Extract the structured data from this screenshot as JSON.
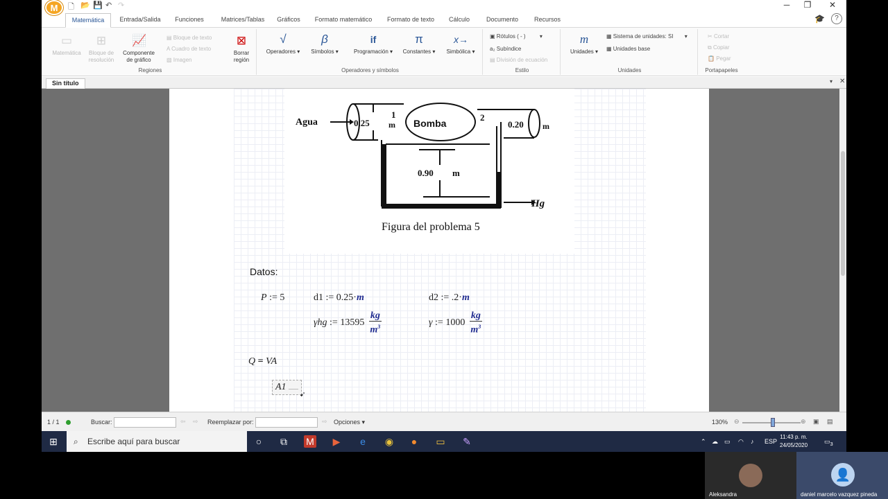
{
  "app": {
    "logo_letter": "M",
    "tabs": [
      "Matemática",
      "Entrada/Salida",
      "Funciones",
      "Matrices/Tablas",
      "Gráficos",
      "Formato matemático",
      "Formato de texto",
      "Cálculo",
      "Documento",
      "Recursos"
    ],
    "active_tab": "Matemática"
  },
  "ribbon": {
    "regions": {
      "label": "Regiones",
      "matematica": "Matemática",
      "bloque_resolucion": "Bloque de resolución",
      "componente_grafico": "Componente de gráfico",
      "bloque_texto": "Bloque de texto",
      "cuadro_texto": "Cuadro de texto",
      "imagen": "Imagen",
      "borrar_region": "Borrar región"
    },
    "operators": {
      "label": "Operadores y símbolos",
      "operadores": "Operadores",
      "simbolos": "Símbolos",
      "programacion": "Programación",
      "constantes": "Constantes",
      "simbolica": "Simbólica"
    },
    "style": {
      "label": "Estilo",
      "rotulos": "Rótulos",
      "rotulos_value": "( - )",
      "subindice": "Subíndice",
      "division": "División de ecuación"
    },
    "units": {
      "label": "Unidades",
      "unidades": "Unidades",
      "sistema": "Sistema de unidades:",
      "sistema_value": "SI",
      "unidades_base": "Unidades base"
    },
    "clipboard": {
      "label": "Portapapeles",
      "cortar": "Cortar",
      "copiar": "Copiar",
      "pegar": "Pegar"
    }
  },
  "document": {
    "tab_title": "Sin título",
    "figure": {
      "agua": "Agua",
      "d1": "0.25",
      "d1_unit": "m",
      "n1": "1",
      "bomba": "Bomba",
      "n2": "2",
      "d2": "0.20",
      "d2_unit": "m",
      "h": "0.90",
      "h_unit": "m",
      "hg": "Hg",
      "caption": "Figura del  problema 5"
    },
    "datos_label": "Datos:",
    "eq_p": {
      "var": "P",
      "op": ":=",
      "val": "5"
    },
    "eq_d1": {
      "var": "d1",
      "op": ":=",
      "val": "0.25",
      "unit": "m"
    },
    "eq_d2": {
      "var": "d2",
      "op": ":=",
      "val": ".2",
      "unit": "m"
    },
    "eq_yhg": {
      "var": "γhg",
      "op": ":=",
      "val": "13595",
      "num": "kg",
      "den": "m",
      "exp": "3"
    },
    "eq_y": {
      "var": "γ",
      "op": ":=",
      "val": "1000",
      "num": "kg",
      "den": "m",
      "exp": "3"
    },
    "eq_q": {
      "lhs": "Q",
      "op": "=",
      "rhs": "VA"
    },
    "eq_a1": "A1"
  },
  "statusbar": {
    "page": "1 / 1",
    "buscar": "Buscar:",
    "reemplazar": "Reemplazar por:",
    "opciones": "Opciones",
    "zoom": "130%"
  },
  "taskbar": {
    "search_placeholder": "Escribe aquí para buscar",
    "lang": "ESP",
    "time": "11:43 p. m.",
    "date": "24/05/2020",
    "notif_count": "3"
  },
  "video": {
    "person1": "Aleksandra",
    "person2": "daniel marcelo vazquez pineda"
  }
}
